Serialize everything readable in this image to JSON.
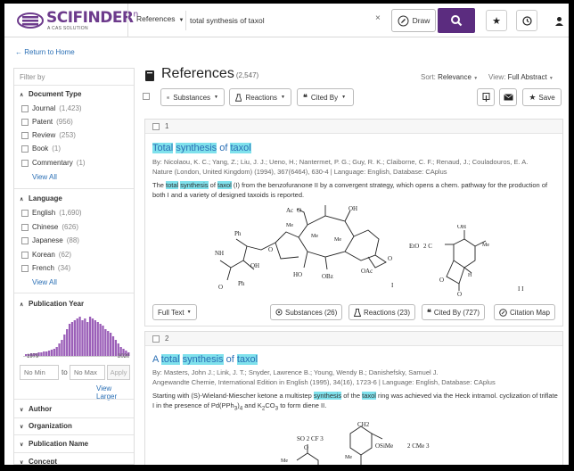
{
  "header": {
    "logo_text": "SCIFINDER",
    "logo_sup": "n",
    "logo_sub": "A CAS SOLUTION",
    "scope_label": "References",
    "search_value": "total synthesis of taxol",
    "draw_label": "Draw"
  },
  "nav": {
    "return_label": "Return to Home"
  },
  "filters": {
    "filter_by": "Filter by",
    "doc_type": {
      "title": "Document Type",
      "items": [
        {
          "label": "Journal",
          "count": "(1,423)"
        },
        {
          "label": "Patent",
          "count": "(956)"
        },
        {
          "label": "Review",
          "count": "(253)"
        },
        {
          "label": "Book",
          "count": "(1)"
        },
        {
          "label": "Commentary",
          "count": "(1)"
        }
      ],
      "view_all": "View All"
    },
    "language": {
      "title": "Language",
      "items": [
        {
          "label": "English",
          "count": "(1,690)"
        },
        {
          "label": "Chinese",
          "count": "(626)"
        },
        {
          "label": "Japanese",
          "count": "(88)"
        },
        {
          "label": "Korean",
          "count": "(62)"
        },
        {
          "label": "French",
          "count": "(34)"
        }
      ],
      "view_all": "View All"
    },
    "pub_year": {
      "title": "Publication Year",
      "start": "1979",
      "end": "2020",
      "min_placeholder": "No Min",
      "to": "to",
      "max_placeholder": "No Max",
      "apply": "Apply",
      "view_larger": "View Larger"
    },
    "collapsed": [
      "Author",
      "Organization",
      "Publication Name",
      "Concept"
    ]
  },
  "main": {
    "title": "References",
    "count": "(2,547)",
    "sort_label": "Sort:",
    "sort_value": "Relevance",
    "view_label": "View:",
    "view_value": "Full Abstract",
    "toolbar": {
      "substances": "Substances",
      "reactions": "Reactions",
      "cited_by": "Cited By",
      "save": "Save"
    }
  },
  "results": [
    {
      "index": "1",
      "title_parts": [
        {
          "t": "Total",
          "hl": true
        },
        {
          "t": " ",
          "hl": false
        },
        {
          "t": "synthesis",
          "hl": true
        },
        {
          "t": " of ",
          "hl": false
        },
        {
          "t": "taxol",
          "hl": true
        }
      ],
      "authors": "By: Nicolaou, K. C.; Yang, Z.; Liu, J. J.; Ueno, H.; Nantermet, P. G.; Guy, R. K.; Claiborne, C. F.; Renaud, J.; Couladouros, E. A.",
      "source": "Nature (London, United Kingdom) (1994), 367(6464), 630-4 | Language: English, Database: CAplus",
      "abstract_parts": [
        {
          "t": "The ",
          "hl": false
        },
        {
          "t": "total",
          "hl": true
        },
        {
          "t": " ",
          "hl": false
        },
        {
          "t": "synthesis",
          "hl": true
        },
        {
          "t": " of ",
          "hl": false
        },
        {
          "t": "taxol",
          "hl": true
        },
        {
          "t": " (I) from the benzofuranone II by a convergent strategy, which opens a chem. pathway for the production of both I and a variety of designed taxoids is reported.",
          "hl": false
        }
      ],
      "actions": {
        "full_text": "Full Text",
        "substances": "Substances (26)",
        "reactions": "Reactions (23)",
        "cited_by": "Cited By (727)",
        "citation_map": "Citation Map"
      },
      "struct_labels": {
        "ac1": "Ac",
        "ac2": "O",
        "oh1": "OH",
        "ph1": "Ph",
        "nh": "NH",
        "ph2": "Ph",
        "oh2": "OH",
        "ho": "HO",
        "obz": "OBz",
        "oac": "OAc",
        "me1": "Me",
        "me2": "Me",
        "me3": "Me",
        "i": "I",
        "eto": "EtO",
        "c2": "2 C",
        "oh3": "OH",
        "ii": "I I",
        "h": "H"
      }
    },
    {
      "index": "2",
      "title_parts": [
        {
          "t": "A ",
          "hl": false
        },
        {
          "t": "total",
          "hl": true
        },
        {
          "t": " ",
          "hl": false
        },
        {
          "t": "synthesis",
          "hl": true
        },
        {
          "t": " of ",
          "hl": false
        },
        {
          "t": "taxol",
          "hl": true
        }
      ],
      "authors": "By: Masters, John J.; Link, J. T.; Snyder, Lawrence B.; Young, Wendy B.; Danishefsky, Samuel J.",
      "source": "Angewandte Chemie, International Edition in English (1995), 34(16), 1723-6 | Language: English, Database: CAplus",
      "abstract_parts": [
        {
          "t": "Starting with (S)-Wieland-Miescher ketone a multistep ",
          "hl": false
        },
        {
          "t": "synthesis",
          "hl": true
        },
        {
          "t": " of the ",
          "hl": false
        },
        {
          "t": "taxol",
          "hl": true
        },
        {
          "t": " ring was achieved via the Heck intramol. cyclization of triflate I in the presence of Pd(PPh",
          "hl": false
        }
      ],
      "abstract_tail": {
        "sub1": "3",
        "mid": ")",
        "sub2": "4",
        "rest": " and K",
        "sub3": "2",
        "rest2": "CO",
        "sub4": "3",
        "end": " to form diene II."
      },
      "struct_labels": {
        "ch2": "CH2",
        "so2cf3": "SO 2 CF 3",
        "me1": "Me",
        "osime": "OSiMe",
        "cme3": "2 CMe 3",
        "me2": "Me"
      }
    }
  ]
}
